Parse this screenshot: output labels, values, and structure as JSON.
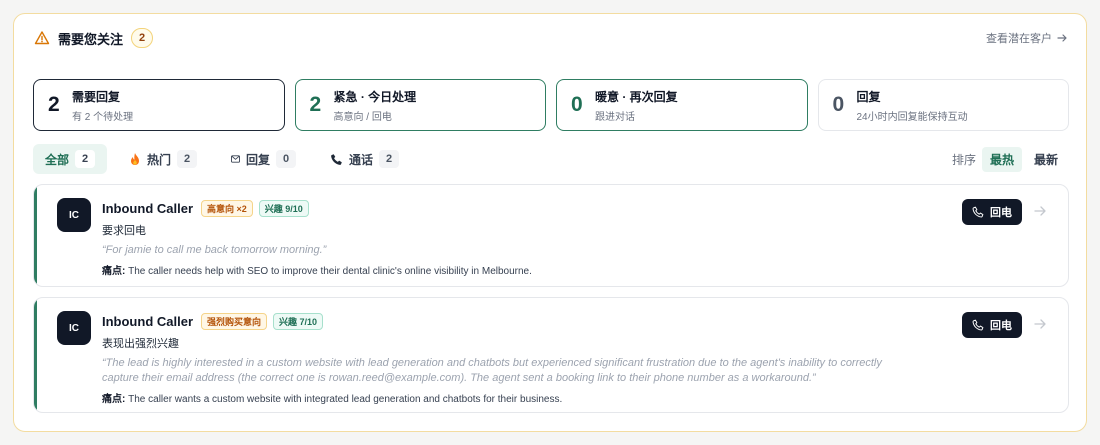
{
  "header": {
    "title": "需要您关注",
    "count": "2",
    "link_label": "查看潜在客户"
  },
  "stats": [
    {
      "num": "2",
      "label": "需要回复",
      "sub": "有 2 个待处理"
    },
    {
      "num": "2",
      "label": "紧急 · 今日处理",
      "sub": "高意向 / 回电"
    },
    {
      "num": "0",
      "label": "暖意 · 再次回复",
      "sub": "跟进对话"
    },
    {
      "num": "0",
      "label": "回复",
      "sub": "24小时内回复能保持互动"
    }
  ],
  "filters": [
    {
      "label": "全部",
      "count": "2"
    },
    {
      "label": "热门",
      "count": "2"
    },
    {
      "label": "回复",
      "count": "0"
    },
    {
      "label": "通话",
      "count": "2"
    }
  ],
  "sort": {
    "label": "排序",
    "options": [
      "最热",
      "最新"
    ]
  },
  "cards": [
    {
      "avatar": "IC",
      "name": "Inbound Caller",
      "tag1": "高意向 ×2",
      "tag2": "兴趣 9/10",
      "subtitle": "要求回电",
      "quote": "“For jamie to call me back tomorrow morning.”",
      "pain_label": "痛点:",
      "pain": "The caller needs help with SEO to improve their dental clinic's online visibility in Melbourne.",
      "button": "回电"
    },
    {
      "avatar": "IC",
      "name": "Inbound Caller",
      "tag1": "强烈购买意向",
      "tag2": "兴趣 7/10",
      "subtitle": "表现出强烈兴趣",
      "quote": "“The lead is highly interested in a custom website with lead generation and chatbots but experienced significant frustration due to the agent's inability to correctly capture their email address (the correct one is rowan.reed@example.com). The agent sent a booking link to their phone number as a workaround.”",
      "pain_label": "痛点:",
      "pain": "The caller wants a custom website with integrated lead generation and chatbots for their business.",
      "button": "回电"
    }
  ],
  "colors": {
    "accent": "#1f6f55",
    "warning": "#d97706",
    "dark": "#111827"
  },
  "icons": {
    "header": "warning-triangle-icon",
    "link": "arrow-right-icon",
    "hot": "fire-icon",
    "reply": "mail-icon",
    "call": "phone-icon"
  }
}
